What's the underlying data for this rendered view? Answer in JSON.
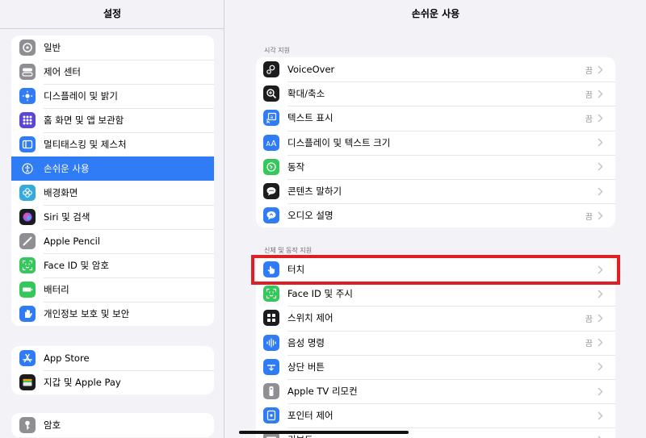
{
  "sidebar": {
    "title": "설정",
    "groups": [
      [
        {
          "label": "일반",
          "icon": "gear-icon",
          "color": "#8e8e93",
          "selected": false
        },
        {
          "label": "제어 센터",
          "icon": "toggles-icon",
          "color": "#8e8e93",
          "selected": false
        },
        {
          "label": "디스플레이 및 밝기",
          "icon": "sun-icon",
          "color": "#2f7cf6",
          "selected": false
        },
        {
          "label": "홈 화면 및 앱 보관함",
          "icon": "app-grid-icon",
          "color": "#5b46d6",
          "selected": false
        },
        {
          "label": "멀티태스킹 및 제스처",
          "icon": "multitasking-icon",
          "color": "#2f7cf6",
          "selected": false
        },
        {
          "label": "손쉬운 사용",
          "icon": "accessibility-icon",
          "color": "#2f7cf6",
          "selected": true
        },
        {
          "label": "배경화면",
          "icon": "flower-icon",
          "color": "#35aadc",
          "selected": false
        },
        {
          "label": "Siri 및 검색",
          "icon": "siri-icon",
          "color": "#1c1c1e",
          "selected": false
        },
        {
          "label": "Apple Pencil",
          "icon": "pencil-icon",
          "color": "#8e8e93",
          "selected": false
        },
        {
          "label": "Face ID 및 암호",
          "icon": "face-id-icon",
          "color": "#34c759",
          "selected": false
        },
        {
          "label": "배터리",
          "icon": "battery-icon",
          "color": "#34c759",
          "selected": false
        },
        {
          "label": "개인정보 보호 및 보안",
          "icon": "hand-icon",
          "color": "#2f7cf6",
          "selected": false
        }
      ],
      [
        {
          "label": "App Store",
          "icon": "app-store-icon",
          "color": "#2f7cf6",
          "selected": false
        },
        {
          "label": "지갑 및 Apple Pay",
          "icon": "wallet-icon",
          "color": "#1c1c1e",
          "selected": false
        }
      ],
      [
        {
          "label": "암호",
          "icon": "key-icon",
          "color": "#8e8e93",
          "selected": false
        }
      ]
    ]
  },
  "main": {
    "title": "손쉬운 사용",
    "sections": [
      {
        "header": "시각 지원",
        "rows": [
          {
            "label": "VoiceOver",
            "value": "끔",
            "icon": "voiceover-icon",
            "color": "#1c1c1e"
          },
          {
            "label": "확대/축소",
            "value": "끔",
            "icon": "zoom-icon",
            "color": "#1c1c1e"
          },
          {
            "label": "텍스트 표시",
            "value": "끔",
            "icon": "hover-text-icon",
            "color": "#2f7cf6"
          },
          {
            "label": "디스플레이 및 텍스트 크기",
            "value": "",
            "icon": "text-size-icon",
            "color": "#2f7cf6"
          },
          {
            "label": "동작",
            "value": "",
            "icon": "motion-icon",
            "color": "#34c759"
          },
          {
            "label": "콘텐츠 말하기",
            "value": "",
            "icon": "speech-bubble-icon",
            "color": "#1c1c1e"
          },
          {
            "label": "오디오 설명",
            "value": "끔",
            "icon": "audio-description-icon",
            "color": "#2f7cf6"
          }
        ]
      },
      {
        "header": "신체 및 동작 지원",
        "rows": [
          {
            "label": "터치",
            "value": "",
            "icon": "touch-hand-icon",
            "color": "#2f7cf6"
          },
          {
            "label": "Face ID 및 주시",
            "value": "",
            "icon": "face-id-icon",
            "color": "#34c759"
          },
          {
            "label": "스위치 제어",
            "value": "끔",
            "icon": "switch-control-icon",
            "color": "#1c1c1e"
          },
          {
            "label": "음성 명령",
            "value": "끔",
            "icon": "voice-control-icon",
            "color": "#2f7cf6"
          },
          {
            "label": "상단 버튼",
            "value": "",
            "icon": "top-button-icon",
            "color": "#2f7cf6"
          },
          {
            "label": "Apple TV 리모컨",
            "value": "",
            "icon": "remote-icon",
            "color": "#8e8e93"
          },
          {
            "label": "포인터 제어",
            "value": "",
            "icon": "pointer-icon",
            "color": "#2f7cf6"
          },
          {
            "label": "키보드",
            "value": "",
            "icon": "keyboard-icon",
            "color": "#8e8e93"
          }
        ]
      }
    ]
  }
}
